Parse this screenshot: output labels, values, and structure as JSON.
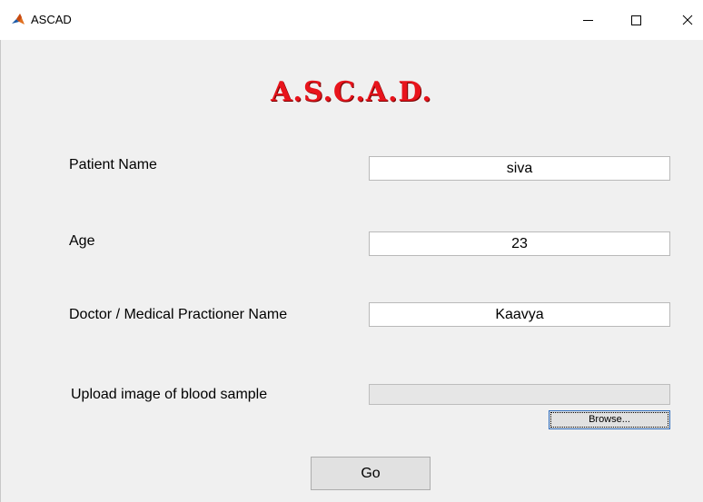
{
  "window": {
    "title": "ASCAD",
    "icon": "matlab-icon",
    "controls": {
      "minimize": "minimize-icon",
      "maximize": "maximize-icon",
      "close": "close-icon"
    }
  },
  "heading": "A.S.C.A.D.",
  "form": {
    "patient_name": {
      "label": "Patient Name",
      "value": "siva"
    },
    "age": {
      "label": "Age",
      "value": "23"
    },
    "doctor": {
      "label": "Doctor / Medical Practioner Name",
      "value": "Kaavya"
    },
    "upload": {
      "label": "Upload image of blood sample",
      "value": ""
    }
  },
  "buttons": {
    "browse": "Browse...",
    "go": "Go"
  },
  "colors": {
    "heading": "#e8141c",
    "background": "#f0f0f0",
    "focus_border": "#2f6dbd"
  }
}
